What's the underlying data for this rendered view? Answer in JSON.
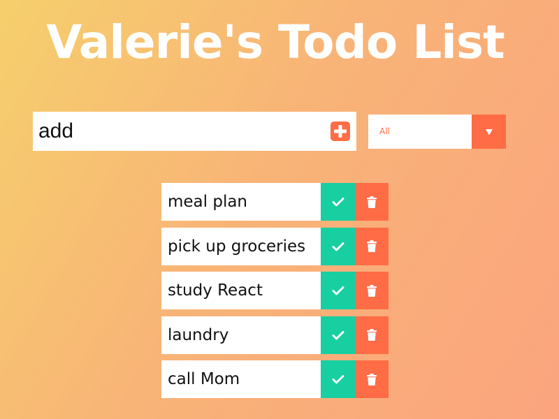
{
  "header": {
    "title": "Valerie's Todo List"
  },
  "add_form": {
    "input_value": "add",
    "add_icon": "plus-square-icon"
  },
  "filter": {
    "selected": "All",
    "arrow_icon": "caret-down-icon"
  },
  "todos": [
    {
      "text": "meal plan"
    },
    {
      "text": "pick up groceries"
    },
    {
      "text": "study React"
    },
    {
      "text": "laundry"
    },
    {
      "text": "call Mom"
    }
  ],
  "item_icons": {
    "complete": "check-icon",
    "delete": "trash-icon"
  },
  "colors": {
    "accent": "#ff6c45",
    "complete": "#17cfa1",
    "gradient_start": "#f6cf6c",
    "gradient_end": "#fba47e"
  }
}
